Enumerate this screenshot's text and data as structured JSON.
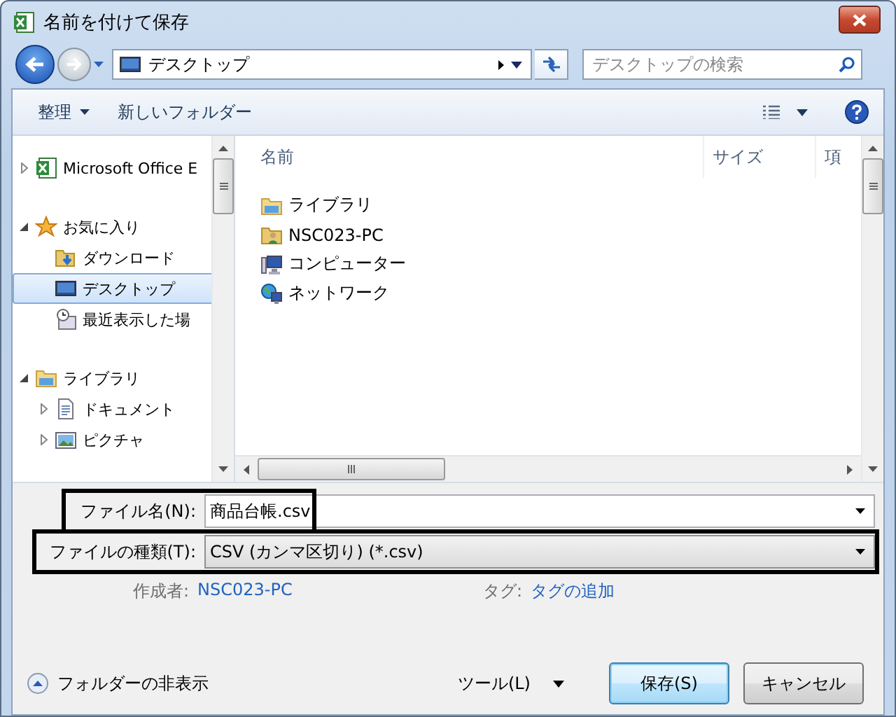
{
  "window": {
    "title": "名前を付けて保存"
  },
  "navigation": {
    "address": "デスクトップ",
    "search": {
      "placeholder": "デスクトップの検索"
    }
  },
  "toolbar": {
    "organize": "整理",
    "new_folder": "新しいフォルダー"
  },
  "nav_pane": {
    "items": [
      {
        "label": "Microsoft Office E",
        "kind": "excel",
        "expanded": false,
        "selected": false
      },
      {
        "label": "お気に入り",
        "kind": "favorites",
        "expanded": true,
        "selected": false,
        "children": [
          {
            "label": "ダウンロード",
            "kind": "downloads",
            "selected": false
          },
          {
            "label": "デスクトップ",
            "kind": "desktop",
            "selected": true
          },
          {
            "label": "最近表示した場",
            "kind": "recent",
            "selected": false
          }
        ]
      },
      {
        "label": "ライブラリ",
        "kind": "library",
        "expanded": true,
        "selected": false,
        "children": [
          {
            "label": "ドキュメント",
            "kind": "documents",
            "expanded": false,
            "selected": false
          },
          {
            "label": "ピクチャ",
            "kind": "pictures",
            "expanded": false,
            "selected": false
          }
        ]
      }
    ]
  },
  "file_list": {
    "columns": [
      "名前",
      "サイズ",
      "項"
    ],
    "rows": [
      {
        "name": "ライブラリ",
        "kind": "library"
      },
      {
        "name": "NSC023-PC",
        "kind": "user"
      },
      {
        "name": "コンピューター",
        "kind": "computer"
      },
      {
        "name": "ネットワーク",
        "kind": "network"
      }
    ]
  },
  "save_form": {
    "file_name": {
      "label": "ファイル名(N):",
      "value": "商品台帳.csv",
      "highlighted": true
    },
    "file_type": {
      "label": "ファイルの種類(T):",
      "value": "CSV (カンマ区切り) (*.csv)",
      "highlighted": true
    },
    "author": {
      "label": "作成者:",
      "value": "NSC023-PC"
    },
    "tags": {
      "label": "タグ:",
      "value": "タグの追加"
    }
  },
  "footer": {
    "hide_folders": "フォルダーの非表示",
    "tools": "ツール(L)",
    "buttons": [
      {
        "label": "保存(S)",
        "default": true
      },
      {
        "label": "キャンセル",
        "default": false
      }
    ]
  }
}
